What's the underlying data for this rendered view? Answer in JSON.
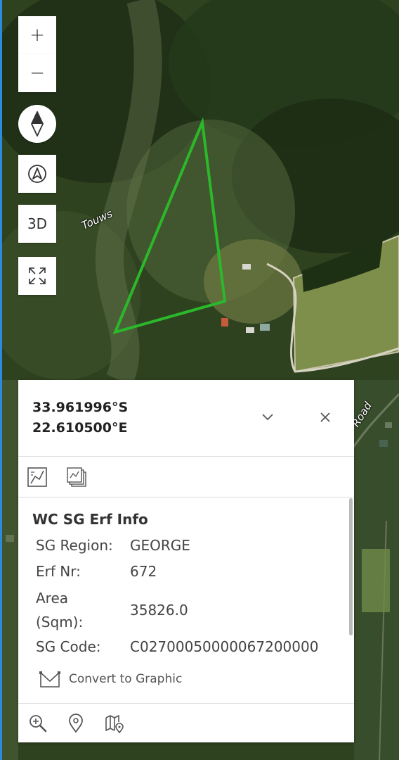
{
  "map": {
    "road_label": "Touws",
    "road_label_2": "Road",
    "parcel_color": "#2bb82b"
  },
  "controls": {
    "zoom_in": "+",
    "zoom_out": "−",
    "view_3d": "3D"
  },
  "popup": {
    "latitude": "33.961996°S",
    "longitude": "22.610500°E",
    "layer_title": "WC SG Erf Info",
    "attributes": [
      {
        "label": "SG Region:",
        "value": "GEORGE"
      },
      {
        "label": "Erf Nr:",
        "value": "672"
      },
      {
        "label": "Area",
        "label2": "(Sqm):",
        "value": "35826.0"
      },
      {
        "label": "SG Code:",
        "value": "C02700050000067200000"
      }
    ],
    "convert_label": "Convert to Graphic"
  },
  "colors": {
    "accent_edge": "#2b8be0",
    "panel_bg": "#ffffff"
  }
}
